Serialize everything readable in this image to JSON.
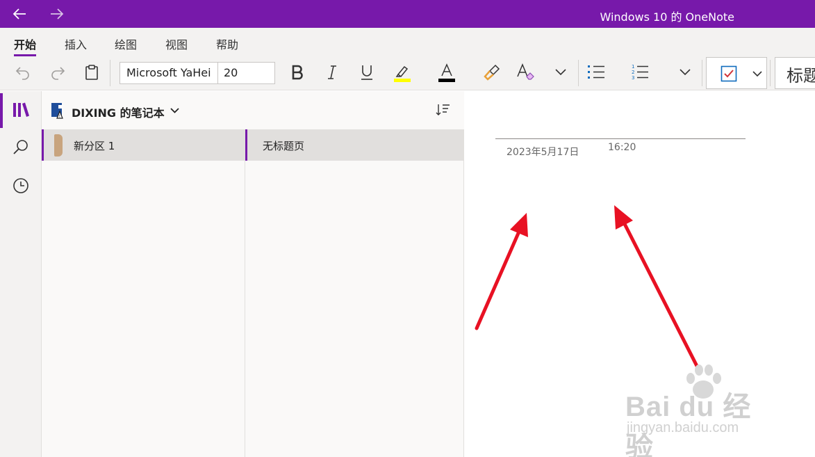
{
  "window": {
    "title": "Windows 10 的 OneNote"
  },
  "ribbon": {
    "tabs": [
      {
        "label": "开始",
        "active": true
      },
      {
        "label": "插入"
      },
      {
        "label": "绘图"
      },
      {
        "label": "视图"
      },
      {
        "label": "帮助"
      }
    ],
    "font_name": "Microsoft YaHei",
    "font_size": "20",
    "style_preview": "标题",
    "highlight_color": "#ffff00",
    "font_color": "#000000"
  },
  "icons": {
    "back": "arrow-left-icon",
    "forward": "arrow-right-icon",
    "undo": "undo-icon",
    "redo": "redo-icon",
    "paste": "clipboard-icon",
    "bold": "bold-icon",
    "italic": "italic-icon",
    "underline": "underline-icon",
    "highlight": "highlighter-icon",
    "font_color": "font-color-icon",
    "format_painter": "format-painter-icon",
    "clear_format": "clear-formatting-icon",
    "bullets": "bulleted-list-icon",
    "numbering": "numbered-list-icon",
    "todo": "todo-checkbox-icon",
    "notebooks": "notebooks-icon",
    "search": "search-icon",
    "recent": "clock-icon",
    "sort": "sort-icon"
  },
  "notebook": {
    "name": "DIXING 的笔记本"
  },
  "sections": [
    {
      "label": "新分区 1",
      "color": "#c8a47e"
    }
  ],
  "pages": [
    {
      "label": "无标题页"
    }
  ],
  "page": {
    "date": "2023年5月17日",
    "time": "16:20"
  },
  "annotation_color": "#e81123",
  "watermark": {
    "brand": "Bai du 经验",
    "url": "jingyan.baidu.com"
  },
  "colors": {
    "accent": "#7719aa"
  }
}
